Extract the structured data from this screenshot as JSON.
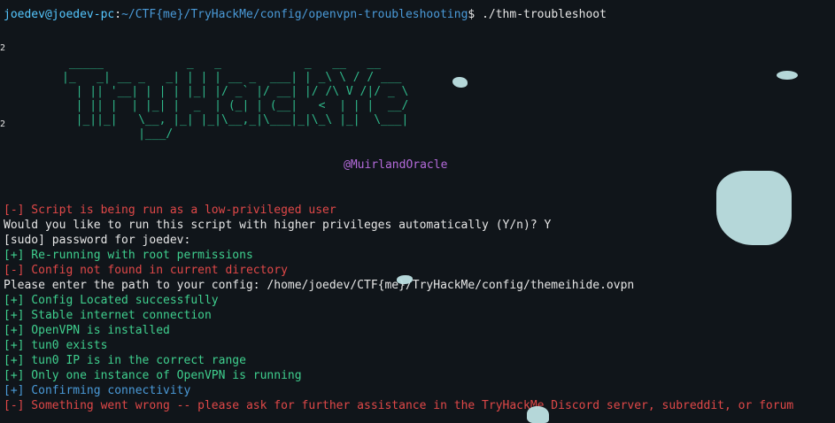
{
  "prompt": {
    "user_host": "joedev@joedev-pc",
    "colon": ":",
    "path": "~/CTF{me}/TryHackMe/config/openvpn-troubleshooting",
    "symbol": "$ ",
    "command": "./thm-troubleshoot"
  },
  "banner": {
    "ascii": " _____            _   _            _   __   __\n|_   _| __ _   _| | | | __ _  ___| | _\\ \\ / / ___\n  | || '__| | | | |_| |/ _` |/ __| |/ /\\ V /|/ _ \\\n  | || |  | |_| |  _  | (_| | (__|   <  | | |  __/\n  |_||_|   \\__, |_| |_|\\__,_|\\___|_|\\_\\ |_|  \\___|\n           |___/",
    "author": "@MuirlandOracle"
  },
  "output_lines": [
    {
      "prefix": "[-]",
      "text": " Script is being run as a low-privileged user",
      "style": "red"
    },
    {
      "prefix": "",
      "text": "Would you like to run this script with higher privileges automatically (Y/n)? Y",
      "style": "white"
    },
    {
      "prefix": "",
      "text": "[sudo] password for joedev:",
      "style": "white"
    },
    {
      "prefix": "[+]",
      "text": " Re-running with root permissions",
      "style": "green"
    },
    {
      "prefix": "[-]",
      "text": " Config not found in current directory",
      "style": "red"
    },
    {
      "prefix": "",
      "text": "Please enter the path to your config: /home/joedev/CTF{me}/TryHackMe/config/themeihide.ovpn",
      "style": "white"
    },
    {
      "prefix": "[+]",
      "text": " Config Located successfully",
      "style": "green"
    },
    {
      "prefix": "[+]",
      "text": " Stable internet connection",
      "style": "green"
    },
    {
      "prefix": "[+]",
      "text": " OpenVPN is installed",
      "style": "green"
    },
    {
      "prefix": "[+]",
      "text": " tun0 exists",
      "style": "green"
    },
    {
      "prefix": "[+]",
      "text": " tun0 IP is in the correct range",
      "style": "green"
    },
    {
      "prefix": "[+]",
      "text": " Only one instance of OpenVPN is running",
      "style": "green"
    },
    {
      "prefix": "[+]",
      "text": " Confirming connectivity",
      "style": "blue"
    },
    {
      "prefix": "[-]",
      "text": " Something went wrong -- please ask for further assistance in the TryHackMe Discord server, subreddit, or forum",
      "style": "red"
    }
  ],
  "edge_marks": [
    "2",
    "2"
  ],
  "colors": {
    "background": "#10151a",
    "red": "#e04848",
    "green": "#3fcf8e",
    "blue": "#4a9ad8",
    "banner": "#2fb88a",
    "author": "#b36ad9"
  }
}
